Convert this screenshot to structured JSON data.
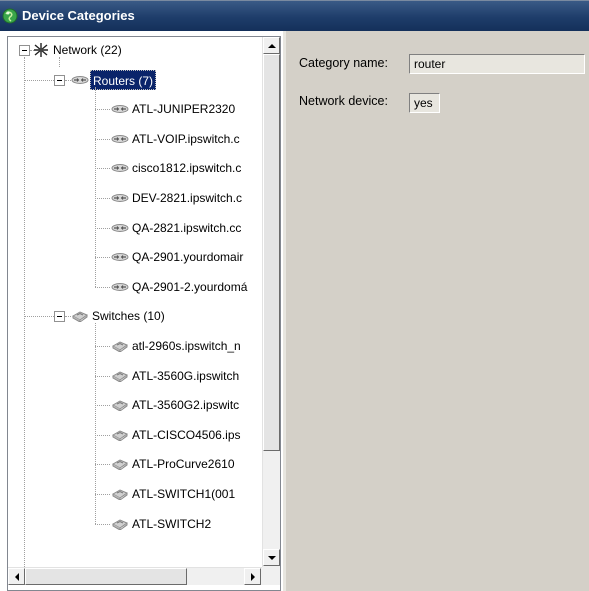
{
  "window": {
    "title": "Device Categories",
    "icon": "globe-icon"
  },
  "tree": {
    "root": {
      "label": "Network (22)",
      "icon": "network-icon"
    },
    "groups": [
      {
        "label": "Routers (7)",
        "icon": "router-icon",
        "selected": true,
        "children": [
          "ATL-JUNIPER2320",
          "ATL-VOIP.ipswitch.c",
          "cisco1812.ipswitch.c",
          "DEV-2821.ipswitch.c",
          "QA-2821.ipswitch.cc",
          "QA-2901.yourdomair",
          "QA-2901-2.yourdomá"
        ]
      },
      {
        "label": "Switches (10)",
        "icon": "switch-icon",
        "selected": false,
        "children": [
          "atl-2960s.ipswitch_n",
          "ATL-3560G.ipswitch",
          "ATL-3560G2.ipswitc",
          "ATL-CISCO4506.ips",
          "ATL-ProCurve2610",
          "ATL-SWITCH1(001",
          "ATL-SWITCH2"
        ]
      }
    ]
  },
  "properties": {
    "category_name_label": "Category name:",
    "category_name_value": "router",
    "network_device_label": "Network device:",
    "network_device_value": "yes"
  },
  "colors": {
    "titlebar": "#1e3d6a",
    "selection": "#0a246a",
    "panel_bg": "#d4d0c8"
  }
}
